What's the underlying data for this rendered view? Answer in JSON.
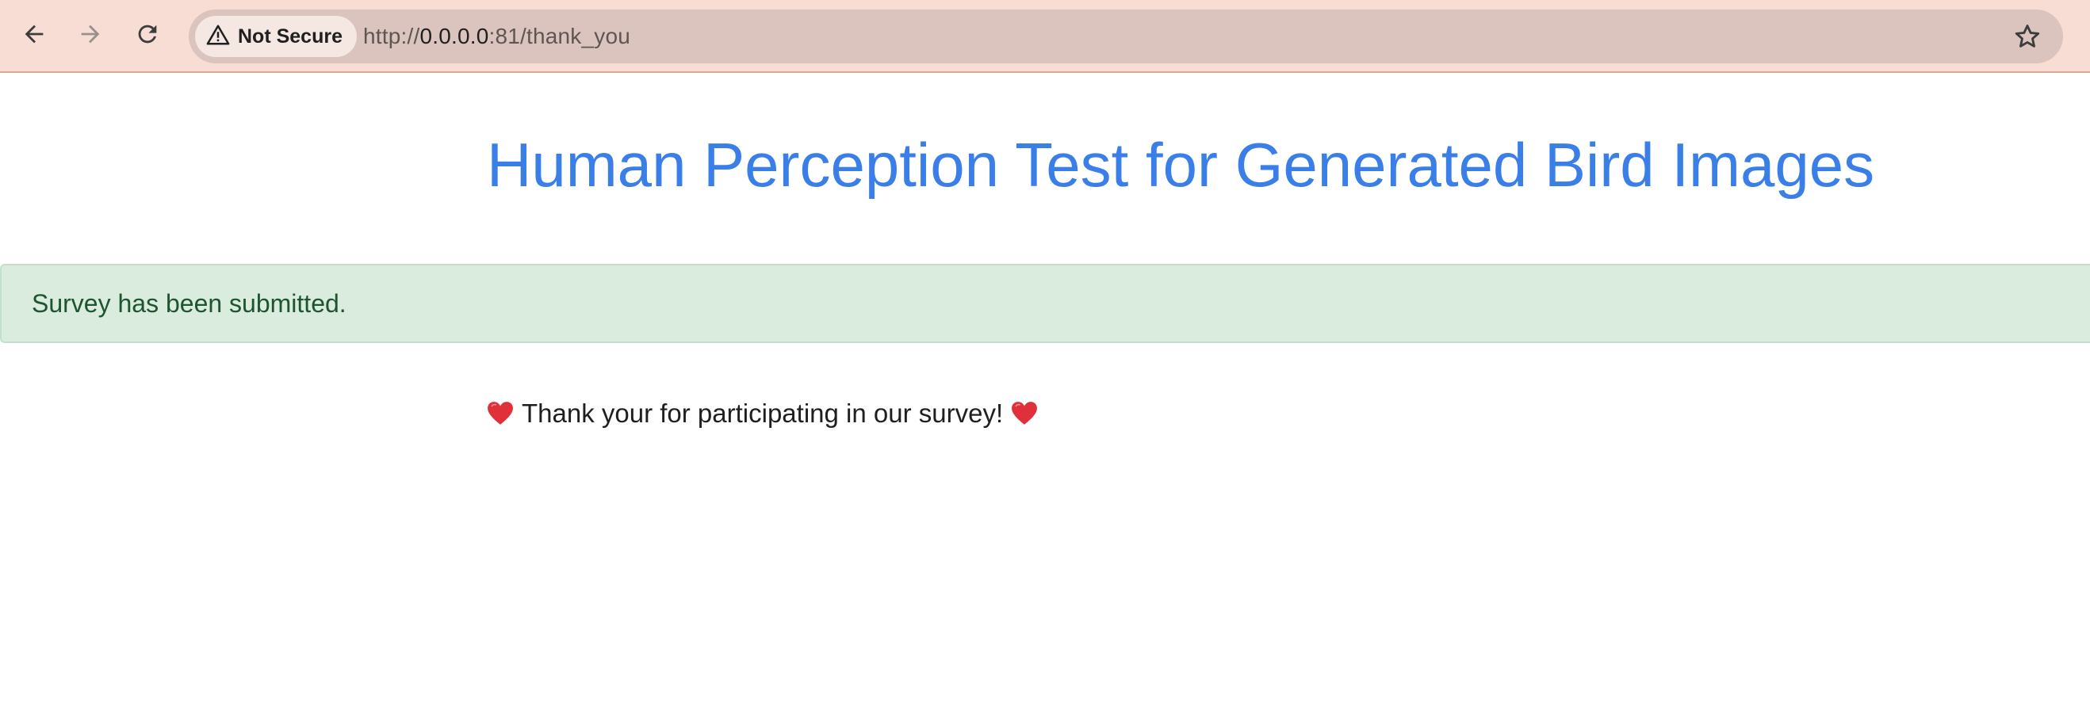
{
  "browser": {
    "security_label": "Not Secure",
    "url_scheme": "http://",
    "url_host": "0.0.0.0",
    "url_rest": ":81/thank_you",
    "icons": [
      "back-arrow-icon",
      "forward-arrow-icon",
      "reload-icon",
      "warning-icon",
      "star-icon"
    ]
  },
  "page": {
    "title": "Human Perception Test for Generated Bird Images",
    "alert_message": "Survey has been submitted.",
    "thank_you_message": "Thank your for participating in our survey!",
    "heart_icon": "red-heart-icon"
  },
  "colors": {
    "toolbar": "#f8ddd5",
    "title": "#3a7ee8",
    "alert_bg": "#d9ecdd",
    "alert_text": "#1e5430",
    "heart": "#e0303a"
  }
}
